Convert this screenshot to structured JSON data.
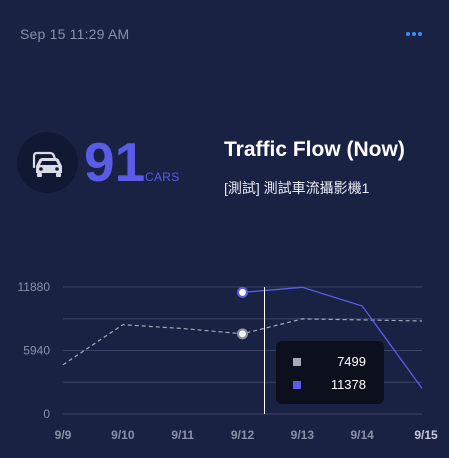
{
  "header": {
    "timestamp": "Sep 15 11:29 AM",
    "more_icon": "more-horizontal-icon"
  },
  "metric": {
    "icon": "cars-icon",
    "value": "91",
    "unit": "CARS",
    "title": "Traffic Flow (Now)",
    "subtitle": "[測試] 測試車流攝影機1"
  },
  "colors": {
    "background": "#1a2244",
    "accent": "#5a5ce8",
    "secondary_series": "#a6a9b8",
    "more_icon": "#3d8bff",
    "tooltip_bg": "#0c0f1c"
  },
  "chart_data": {
    "type": "line",
    "x": [
      "9/9",
      "9/10",
      "9/11",
      "9/12",
      "9/13",
      "9/14",
      "9/15"
    ],
    "ylim": [
      0,
      11880
    ],
    "yticks": [
      "11880",
      "5940",
      "0"
    ],
    "grid": true,
    "series": [
      {
        "style": "dashed",
        "color": "#a6a9b8",
        "values": [
          4600,
          8350,
          8000,
          7499,
          8900,
          8800,
          8700
        ]
      },
      {
        "style": "solid",
        "color": "#5a5ce8",
        "values": [
          null,
          null,
          null,
          11378,
          11850,
          10100,
          2400
        ]
      }
    ],
    "highlight_index": 3,
    "tooltip": {
      "rows": [
        {
          "color": "#a6a9b8",
          "value": "7499"
        },
        {
          "color": "#5a5ce8",
          "value": "11378"
        }
      ]
    }
  }
}
